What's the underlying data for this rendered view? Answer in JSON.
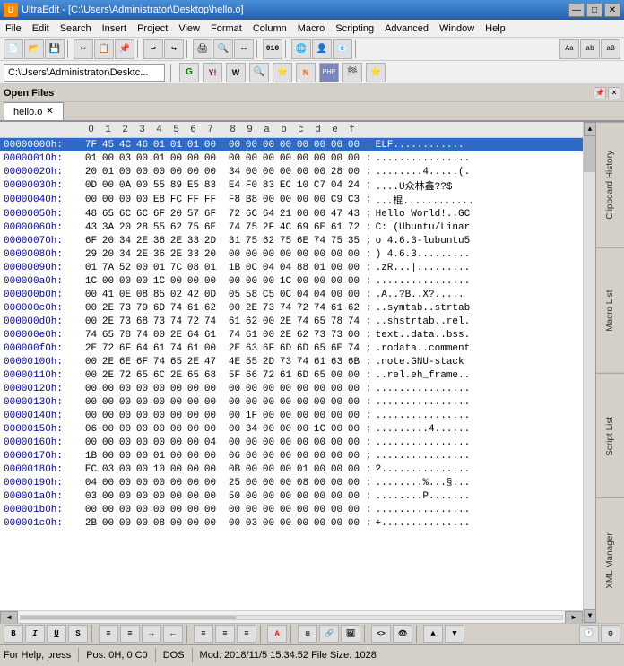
{
  "title_bar": {
    "icon_label": "U",
    "title": "UltraEdit - [C:\\Users\\Administrator\\Desktop\\hello.o]",
    "minimize": "—",
    "maximize": "□",
    "close": "✕"
  },
  "menu_bar": {
    "items": [
      "File",
      "Edit",
      "Search",
      "Insert",
      "Project",
      "View",
      "Format",
      "Column",
      "Macro",
      "Scripting",
      "Advanced",
      "Window",
      "Help"
    ]
  },
  "address_bar": {
    "path": "C:\\Users\\Administrator\\Desktc..."
  },
  "open_files": {
    "label": "Open Files"
  },
  "tabs": [
    {
      "label": "hello.o",
      "active": true
    }
  ],
  "hex_header": {
    "addr_label": "",
    "cols": [
      "0",
      "1",
      "2",
      "3",
      "4",
      "5",
      "6",
      "7",
      "8",
      "9",
      "a",
      "b",
      "c",
      "d",
      "e",
      "f"
    ]
  },
  "hex_rows": [
    {
      "addr": "00000000h:",
      "bytes": "7F 45 4C 46 01 01 01 00  00 00 00 00 00 00 00 00",
      "ascii": ";ELF............"
    },
    {
      "addr": "00000010h:",
      "bytes": "01 00 03 00 01 00 00 00  00 00 00 00 00 00 00 00",
      "ascii": ";................"
    },
    {
      "addr": "00000020h:",
      "bytes": "20 01 00 00 00 00 00 00  34 00 00 00 00 00 28 00",
      "ascii": "; ........4.....(."
    },
    {
      "addr": "00000030h:",
      "bytes": "0D 00 0A 00 55 89 E5 83  E4 F0 83 EC 10 C7 04 24",
      "ascii": ";....U众林鑫??$"
    },
    {
      "addr": "00000040h:",
      "bytes": "00 00 00 00 E8 FC FF FF  F8 B8 00 00 00 00 C9 C3",
      "ascii": ";...棍............"
    },
    {
      "addr": "00000050h:",
      "bytes": "48 65 6C 6C 6F 20 57 6F  72 6C 64 21 00 00 47 43",
      "ascii": ";Hello World!..GC"
    },
    {
      "addr": "00000060h:",
      "bytes": "43 3A 20 28 55 62 75 6E  74 75 2F 4C 69 6E 61 72",
      "ascii": ";C: (Ubuntu/Linar"
    },
    {
      "addr": "00000070h:",
      "bytes": "6F 20 34 2E 36 2E 33 2D  31 75 62 75 6E 74 75 35",
      "ascii": ";o 4.6.3-lubuntu5"
    },
    {
      "addr": "00000080h:",
      "bytes": "29 20 34 2E 36 2E 33 20  00 00 00 00 00 00 00 00",
      "ascii": ";) 4.6.3........."
    },
    {
      "addr": "00000090h:",
      "bytes": "01 7A 52 00 01 7C 08 01  1B 0C 04 04 88 01 00 00",
      "ascii": ";.zR...|........."
    },
    {
      "addr": "000000a0h:",
      "bytes": "1C 00 00 00 1C 00 00 00  00 00 00 1C 00 00 00 00",
      "ascii": ";................"
    },
    {
      "addr": "000000b0h:",
      "bytes": "00 41 0E 08 85 02 42 0D  05 58 C5 0C 04 04 00 00",
      "ascii": ";.A..?B..X?....."
    },
    {
      "addr": "000000c0h:",
      "bytes": "00 2E 73 79 6D 74 61 62  00 2E 73 74 72 74 61 62",
      "ascii": ";..symtab..strtab"
    },
    {
      "addr": "000000d0h:",
      "bytes": "00 2E 73 68 73 74 72 74  61 62 00 2E 74 65 78 74",
      "ascii": ";..shstrtab..rel."
    },
    {
      "addr": "000000e0h:",
      "bytes": "74 65 78 74 00 2E 64 61  74 61 00 2E 62 73 73 00",
      "ascii": ";text..data..bss."
    },
    {
      "addr": "000000f0h:",
      "bytes": "2E 72 6F 64 61 74 61 00  2E 63 6F 6D 6D 65 6E 74",
      "ascii": ";.rodata..comment"
    },
    {
      "addr": "00000100h:",
      "bytes": "00 2E 6E 6F 74 65 2E 47  4E 55 2D 73 74 61 63 6B",
      "ascii": ";.note.GNU-stack"
    },
    {
      "addr": "00000110h:",
      "bytes": "00 2E 72 65 6C 2E 65 68  5F 66 72 61 6D 65 00 00",
      "ascii": ";..rel.eh_frame.."
    },
    {
      "addr": "00000120h:",
      "bytes": "00 00 00 00 00 00 00 00  00 00 00 00 00 00 00 00",
      "ascii": ";................"
    },
    {
      "addr": "00000130h:",
      "bytes": "00 00 00 00 00 00 00 00  00 00 00 00 00 00 00 00",
      "ascii": ";................"
    },
    {
      "addr": "00000140h:",
      "bytes": "00 00 00 00 00 00 00 00  00 1F 00 00 00 00 00 00",
      "ascii": ";................"
    },
    {
      "addr": "00000150h:",
      "bytes": "06 00 00 00 00 00 00 00  00 34 00 00 00 1C 00 00",
      "ascii": ";.........4......"
    },
    {
      "addr": "00000160h:",
      "bytes": "00 00 00 00 00 00 00 04  00 00 00 00 00 00 00 00",
      "ascii": ";................"
    },
    {
      "addr": "00000170h:",
      "bytes": "1B 00 00 00 01 00 00 00  06 00 00 00 00 00 00 00",
      "ascii": ";................"
    },
    {
      "addr": "00000180h:",
      "bytes": "EC 03 00 00 10 00 00 00  0B 00 00 00 01 00 00 00",
      "ascii": ";?..............."
    },
    {
      "addr": "00000190h:",
      "bytes": "04 00 00 00 00 00 00 00  25 00 00 00 08 00 00 00",
      "ascii": ";........%...§..."
    },
    {
      "addr": "000001a0h:",
      "bytes": "03 00 00 00 00 00 00 00  50 00 00 00 00 00 00 00",
      "ascii": ";........P......."
    },
    {
      "addr": "000001b0h:",
      "bytes": "00 00 00 00 00 00 00 00  00 00 00 00 00 00 00 00",
      "ascii": ";................"
    },
    {
      "addr": "000001c0h:",
      "bytes": "2B 00 00 00 08 00 00 00  00 03 00 00 00 00 00 00",
      "ascii": ";+..............."
    }
  ],
  "right_panels": [
    {
      "label": "Clipboard History"
    },
    {
      "label": "Macro List"
    },
    {
      "label": "Script List"
    },
    {
      "label": "XML Manager"
    }
  ],
  "status_bar": {
    "help": "For Help, press",
    "position": "Pos: 0H, 0 C0",
    "format": "DOS",
    "modified": "Mod: 2018/11/5 15:34:52 File Size: 1028"
  },
  "bottom_toolbar": {
    "buttons": [
      "B",
      "I",
      "U",
      "S",
      "¶",
      "≡",
      "≡",
      "≡",
      "A",
      "↕",
      "↔",
      "ABC",
      "↕",
      "↔",
      "¶",
      "↕",
      "↔",
      "↑",
      "↓",
      "→",
      "←",
      "§",
      "P",
      "♦",
      "↑↓",
      "→←",
      "⌦",
      "≡",
      "↕",
      "T"
    ]
  }
}
